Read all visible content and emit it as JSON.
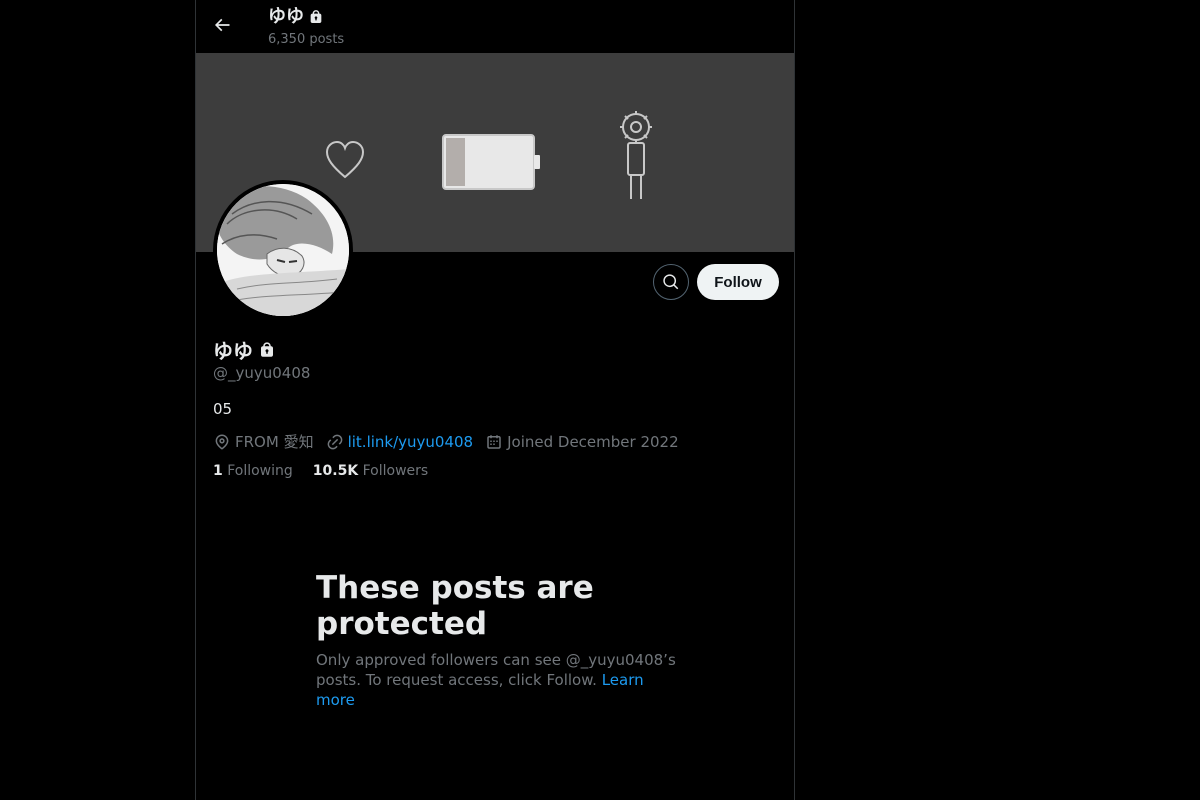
{
  "header": {
    "name": "ゆゆ",
    "posts_count": "6,350 posts"
  },
  "profile": {
    "display_name": "ゆゆ",
    "handle": "@_yuyu0408",
    "bio": "05",
    "location": "FROM 愛知",
    "website": "lit.link/yuyu0408",
    "joined": "Joined December 2022",
    "following_count": "1",
    "following_label": "Following",
    "followers_count": "10.5K",
    "followers_label": "Followers"
  },
  "actions": {
    "follow_label": "Follow"
  },
  "protected": {
    "title": "These posts are protected",
    "body": "Only approved followers can see @_yuyu0408’s posts. To request access, click Follow.",
    "learn_more": "Learn more"
  },
  "icons": {
    "back": "arrow-left-icon",
    "lock": "lock-icon",
    "search": "search-icon",
    "location": "location-pin-icon",
    "link": "link-icon",
    "calendar": "calendar-icon"
  },
  "colors": {
    "background": "#000000",
    "text_primary": "#e7e9ea",
    "text_secondary": "#71767b",
    "link": "#1d9bf0",
    "follow_button_bg": "#eff3f4",
    "banner_bg": "#3d3d3d"
  }
}
